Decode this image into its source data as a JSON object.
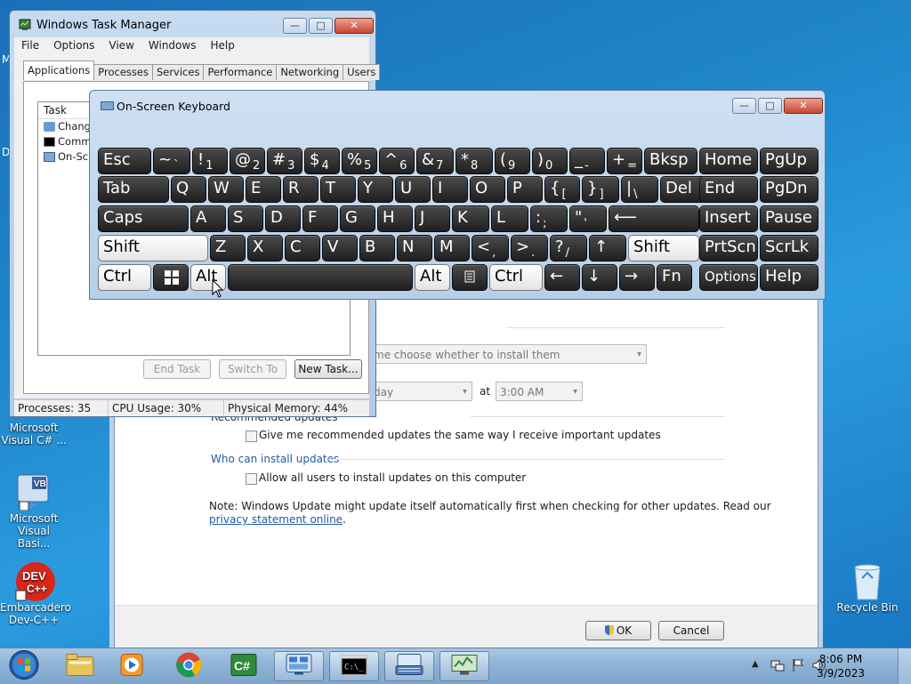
{
  "desktop": {
    "icons": [
      {
        "label_line1": "Microsoft",
        "label_line2": "Visual C# ..."
      },
      {
        "label_line1": "Microsoft",
        "label_line2": "Visual Basi..."
      },
      {
        "label_line1": "Embarcadero",
        "label_line2": "Dev-C++"
      },
      {
        "label_line1": "Recycle Bin",
        "label_line2": ""
      }
    ],
    "edge_letters": [
      "M",
      "D"
    ]
  },
  "windows_update": {
    "install_combo": "me choose whether to install them",
    "day_combo": "day",
    "at_label": "at",
    "time_combo": "3:00 AM",
    "recommended_heading": "Recommended updates",
    "recommended_checkbox": "Give me recommended updates the same way I receive important updates",
    "who_heading": "Who can install updates",
    "who_checkbox": "Allow all users to install updates on this computer",
    "note": "Note: Windows Update might update itself automatically first when checking for other updates.  Read our",
    "privacy_link": "privacy statement online",
    "period": ".",
    "ok": "OK",
    "cancel": "Cancel"
  },
  "task_manager": {
    "title": "Windows Task Manager",
    "menu": [
      "File",
      "Options",
      "View",
      "Windows",
      "Help"
    ],
    "tabs": [
      "Applications",
      "Processes",
      "Services",
      "Performance",
      "Networking",
      "Users"
    ],
    "active_tab": "Applications",
    "column_task": "Task",
    "tasks": [
      "Change",
      "Comma",
      "On-Scre"
    ],
    "buttons": {
      "end_task": "End Task",
      "switch_to": "Switch To",
      "new_task": "New Task..."
    },
    "status": {
      "processes": "Processes: 35",
      "cpu": "CPU Usage: 30%",
      "memory": "Physical Memory: 44%"
    }
  },
  "osk": {
    "title": "On-Screen Keyboard",
    "rows": [
      [
        {
          "m": "Esc"
        },
        {
          "m": "~",
          "s": "`"
        },
        {
          "m": "!",
          "s": "1"
        },
        {
          "m": "@",
          "s": "2"
        },
        {
          "m": "#",
          "s": "3"
        },
        {
          "m": "$",
          "s": "4"
        },
        {
          "m": "%",
          "s": "5"
        },
        {
          "m": "^",
          "s": "6"
        },
        {
          "m": "&",
          "s": "7"
        },
        {
          "m": "*",
          "s": "8"
        },
        {
          "m": "(",
          "s": "9"
        },
        {
          "m": ")",
          "s": "0"
        },
        {
          "m": "_",
          "s": "-"
        },
        {
          "m": "+",
          "s": "="
        },
        {
          "m": "Bksp"
        },
        {
          "m": "Home"
        },
        {
          "m": "PgUp"
        }
      ],
      [
        {
          "m": "Tab"
        },
        {
          "m": "Q"
        },
        {
          "m": "W"
        },
        {
          "m": "E"
        },
        {
          "m": "R"
        },
        {
          "m": "T"
        },
        {
          "m": "Y"
        },
        {
          "m": "U"
        },
        {
          "m": "I"
        },
        {
          "m": "O"
        },
        {
          "m": "P"
        },
        {
          "m": "{",
          "s": "["
        },
        {
          "m": "}",
          "s": "]"
        },
        {
          "m": "|",
          "s": "\\"
        },
        {
          "m": "Del"
        },
        {
          "m": "End"
        },
        {
          "m": "PgDn"
        }
      ],
      [
        {
          "m": "Caps"
        },
        {
          "m": "A"
        },
        {
          "m": "S"
        },
        {
          "m": "D"
        },
        {
          "m": "F"
        },
        {
          "m": "G"
        },
        {
          "m": "H"
        },
        {
          "m": "J"
        },
        {
          "m": "K"
        },
        {
          "m": "L"
        },
        {
          "m": ":",
          "s": ";"
        },
        {
          "m": "\"",
          "s": "'"
        },
        {
          "m": "⟵"
        },
        {
          "m": "Insert"
        },
        {
          "m": "Pause"
        }
      ],
      [
        {
          "m": "Shift"
        },
        {
          "m": "Z"
        },
        {
          "m": "X"
        },
        {
          "m": "C"
        },
        {
          "m": "V"
        },
        {
          "m": "B"
        },
        {
          "m": "N"
        },
        {
          "m": "M"
        },
        {
          "m": "<",
          "s": ","
        },
        {
          "m": ">",
          "s": "."
        },
        {
          "m": "?",
          "s": "/"
        },
        {
          "m": "↑"
        },
        {
          "m": "Shift"
        },
        {
          "m": "PrtScn"
        },
        {
          "m": "ScrLk"
        }
      ],
      [
        {
          "m": "Ctrl"
        },
        {
          "m": ""
        },
        {
          "m": "Alt"
        },
        {
          "m": ""
        },
        {
          "m": "Alt"
        },
        {
          "m": ""
        },
        {
          "m": "Ctrl"
        },
        {
          "m": "←"
        },
        {
          "m": "↓"
        },
        {
          "m": "→"
        },
        {
          "m": "Fn"
        },
        {
          "m": "Options"
        },
        {
          "m": "Help"
        }
      ]
    ],
    "key_icons": [
      "windows-logo-icon",
      "context-menu-icon"
    ]
  },
  "taskbar": {
    "pinned": [
      "start-orb-icon",
      "explorer-icon",
      "media-player-icon",
      "chrome-icon",
      "csharp-ide-icon",
      "task-manager-icon",
      "cmd-icon",
      "on-screen-keyboard-icon",
      "network-app-icon"
    ],
    "clock_time": "8:06 PM",
    "clock_date": "3/9/2023"
  },
  "colors": {
    "accent": "#1e5ba8",
    "key_dark": "#2a2a2a",
    "key_light": "#ffffff",
    "close_red": "#c8462f"
  }
}
